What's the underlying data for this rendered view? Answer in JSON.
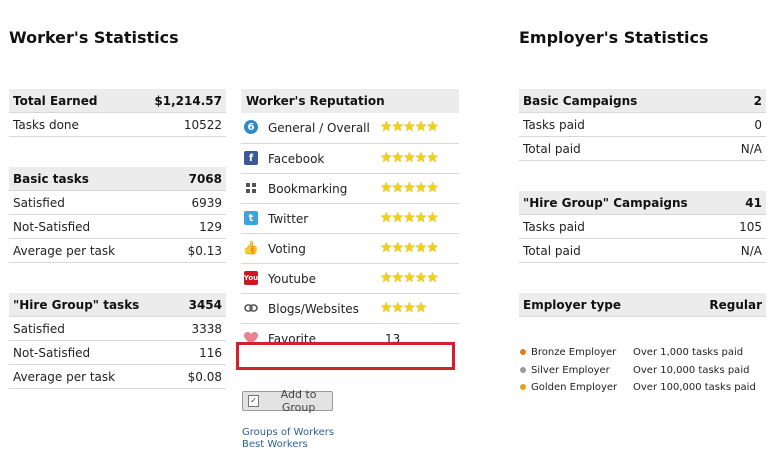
{
  "worker_title": "Worker's Statistics",
  "employer_title": "Employer's Statistics",
  "earned": {
    "label": "Total Earned",
    "value": "$1,214.57",
    "tasks_label": "Tasks done",
    "tasks_value": "10522"
  },
  "basic_tasks": {
    "label": "Basic tasks",
    "value": "7068",
    "rows": [
      {
        "label": "Satisfied",
        "value": "6939"
      },
      {
        "label": "Not-Satisfied",
        "value": "129"
      },
      {
        "label": "Average per task",
        "value": "$0.13"
      }
    ]
  },
  "hire_tasks": {
    "label": "\"Hire Group\" tasks",
    "value": "3454",
    "rows": [
      {
        "label": "Satisfied",
        "value": "3338"
      },
      {
        "label": "Not-Satisfied",
        "value": "116"
      },
      {
        "label": "Average per task",
        "value": "$0.08"
      }
    ]
  },
  "reputation": {
    "title": "Worker's Reputation",
    "rows": [
      {
        "label": "General / Overall",
        "icon": "general-icon",
        "stars": 5
      },
      {
        "label": "Facebook",
        "icon": "facebook-icon",
        "stars": 5
      },
      {
        "label": "Bookmarking",
        "icon": "bookmarking-icon",
        "stars": 5
      },
      {
        "label": "Twitter",
        "icon": "twitter-icon",
        "stars": 5
      },
      {
        "label": "Voting",
        "icon": "thumbs-up-icon",
        "stars": 5
      },
      {
        "label": "Youtube",
        "icon": "youtube-icon",
        "stars": 5
      },
      {
        "label": "Blogs/Websites",
        "icon": "link-icon",
        "stars": 4
      }
    ],
    "favorite": {
      "label": "Favorite",
      "value": "13",
      "icon": "heart-icon"
    },
    "highlight_color": "#d3222e"
  },
  "add_group_label": "Add to Group",
  "links": {
    "groups": "Groups of Workers",
    "best": "Best Workers"
  },
  "employer_basic": {
    "label": "Basic Campaigns",
    "value": "2",
    "rows": [
      {
        "label": "Tasks paid",
        "value": "0"
      },
      {
        "label": "Total paid",
        "value": "N/A"
      }
    ]
  },
  "employer_hire": {
    "label": "\"Hire Group\" Campaigns",
    "value": "41",
    "rows": [
      {
        "label": "Tasks paid",
        "value": "105"
      },
      {
        "label": "Total paid",
        "value": "N/A"
      }
    ]
  },
  "employer_type": {
    "label": "Employer type",
    "value": "Regular"
  },
  "employer_levels": [
    {
      "name": "Bronze Employer",
      "desc": "Over 1,000 tasks paid",
      "color": "#e07b1f"
    },
    {
      "name": "Silver Employer",
      "desc": "Over 10,000 tasks paid",
      "color": "#9a9a9a"
    },
    {
      "name": "Golden Employer",
      "desc": "Over 100,000 tasks paid",
      "color": "#e0a21f"
    }
  ],
  "star_char": "★"
}
